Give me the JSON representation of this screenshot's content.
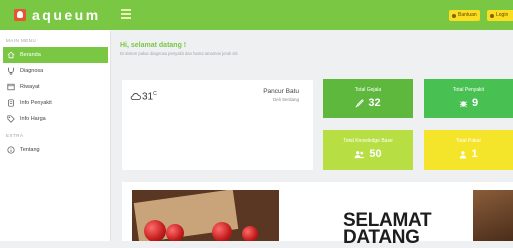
{
  "brand": {
    "name": "aqueum"
  },
  "header": {
    "help_label": "Bantuan",
    "login_label": "Login"
  },
  "sidebar": {
    "main_section": "MAIN MENU",
    "items": [
      {
        "label": "Beranda",
        "icon": "home-icon",
        "active": true
      },
      {
        "label": "Diagnosa",
        "icon": "stethoscope-icon"
      },
      {
        "label": "Riwayat",
        "icon": "history-icon"
      },
      {
        "label": "Info Penyakit",
        "icon": "virus-icon"
      },
      {
        "label": "Info Harga",
        "icon": "tag-icon"
      }
    ],
    "extra_section": "EXTRA",
    "extra_items": [
      {
        "label": "Tentang",
        "icon": "info-icon"
      }
    ]
  },
  "welcome": {
    "title": "Hi, selamat datang !",
    "subtitle": "Di sistem pakar diagnosa penyakit dan hama tanaman jeruk siti"
  },
  "weather": {
    "temp": "31",
    "unit": "C",
    "city": "Pancur Batu",
    "district": "Deli Serdang",
    "icon": "cloud-icon"
  },
  "stats": [
    {
      "label": "Total Gejala",
      "value": "32",
      "icon": "eyedropper-icon",
      "color": "#5fb83e"
    },
    {
      "label": "Total Penyakit",
      "value": "9",
      "icon": "bug-icon",
      "color": "#49c152"
    },
    {
      "label": "Total Knowledge Base",
      "value": "50",
      "icon": "users-icon",
      "color": "#b7df44"
    },
    {
      "label": "Total Pakar",
      "value": "1",
      "icon": "user-icon",
      "color": "#f4e52a"
    }
  ],
  "banner": {
    "line1": "SELAMAT",
    "line2": "DATANG"
  },
  "colors": {
    "primary": "#79c743",
    "accent": "#fddd1f"
  }
}
